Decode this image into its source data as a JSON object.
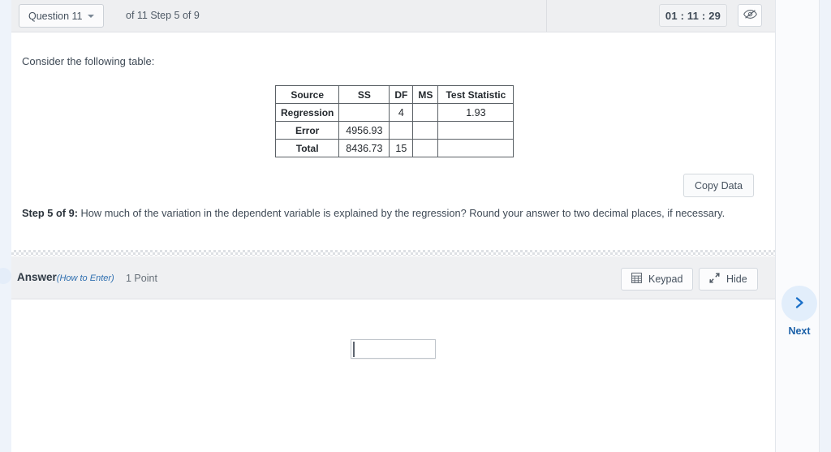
{
  "header": {
    "question_button_label": "Question 11",
    "caret_icon": "chevron-down-icon",
    "step_label": "of 11 Step 5 of 9",
    "timer": "01 : 11 : 29",
    "hide_timer_icon": "eye-slash-icon"
  },
  "body": {
    "intro_text": "Consider the following table:",
    "copy_data_label": "Copy Data",
    "prompt_prefix": "Step 5 of 9:",
    "prompt_text": " How much of the variation in the dependent variable is explained by the regression? Round your answer to two decimal places, if necessary."
  },
  "table": {
    "columns": [
      "Source",
      "SS",
      "DF",
      "MS",
      "Test Statistic"
    ],
    "rows": [
      {
        "source": "Regression",
        "ss": "",
        "df": "4",
        "ms": "",
        "test_statistic": "1.93"
      },
      {
        "source": "Error",
        "ss": "4956.93",
        "df": "",
        "ms": "",
        "test_statistic": ""
      },
      {
        "source": "Total",
        "ss": "8436.73",
        "df": "15",
        "ms": "",
        "test_statistic": ""
      }
    ]
  },
  "answer": {
    "label": "Answer",
    "how_to_enter": "(How to Enter)",
    "points": "1 Point",
    "keypad_label": "Keypad",
    "keypad_icon": "keypad-grid-icon",
    "hide_label": "Hide",
    "hide_icon": "collapse-arrows-icon",
    "input_value": "",
    "input_placeholder": ""
  },
  "navigation": {
    "next_label": "Next",
    "next_icon": "chevron-right-icon"
  },
  "colors": {
    "accent": "#1b60a8",
    "link": "#2f6fb0",
    "next_circle": "#e2eefb",
    "header_bg": "#eeeff1",
    "answer_bar_bg": "#eff0f2"
  }
}
